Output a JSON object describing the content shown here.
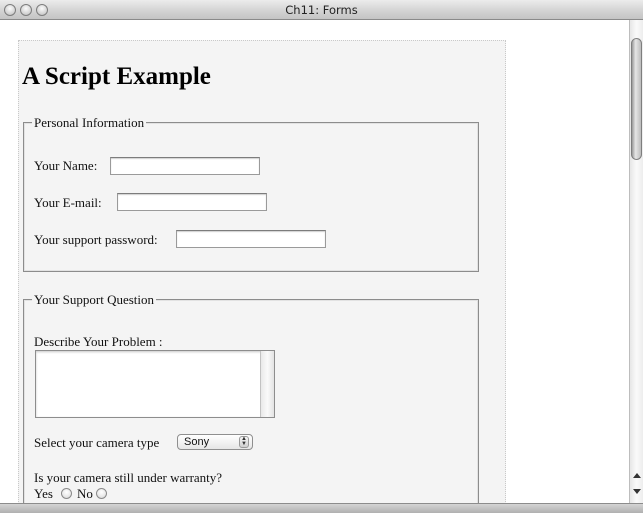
{
  "window": {
    "title": "Ch11: Forms"
  },
  "page": {
    "heading": "A Script Example",
    "personal": {
      "legend": "Personal Information",
      "name_label": "Your Name:",
      "email_label": "Your E-mail:",
      "password_label": "Your support password:"
    },
    "support": {
      "legend": "Your Support Question",
      "problem_label": "Describe Your Problem :",
      "camera_label": "Select your camera type",
      "camera_selected": "Sony",
      "warranty_question": "Is your camera still under warranty?",
      "yes_label": "Yes",
      "no_label": "No"
    }
  }
}
